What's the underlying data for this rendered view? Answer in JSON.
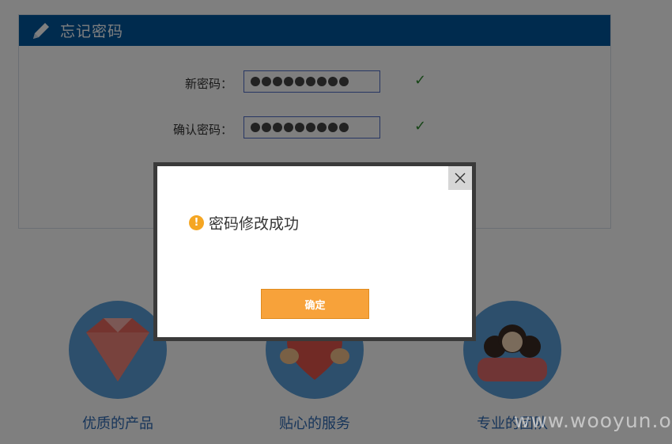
{
  "panel": {
    "title": "忘记密码",
    "new_password_label": "新密码：",
    "confirm_password_label": "确认密码：",
    "header_color": "#00569c"
  },
  "features": [
    {
      "label": "优质的产品",
      "icon": "diamond-icon"
    },
    {
      "label": "贴心的服务",
      "icon": "heart-icon"
    },
    {
      "label": "专业的团队",
      "icon": "team-icon"
    }
  ],
  "dialog": {
    "message": "密码修改成功",
    "ok_label": "确定",
    "accent_color": "#f7a23a"
  },
  "watermark": "www.wooyun.org"
}
